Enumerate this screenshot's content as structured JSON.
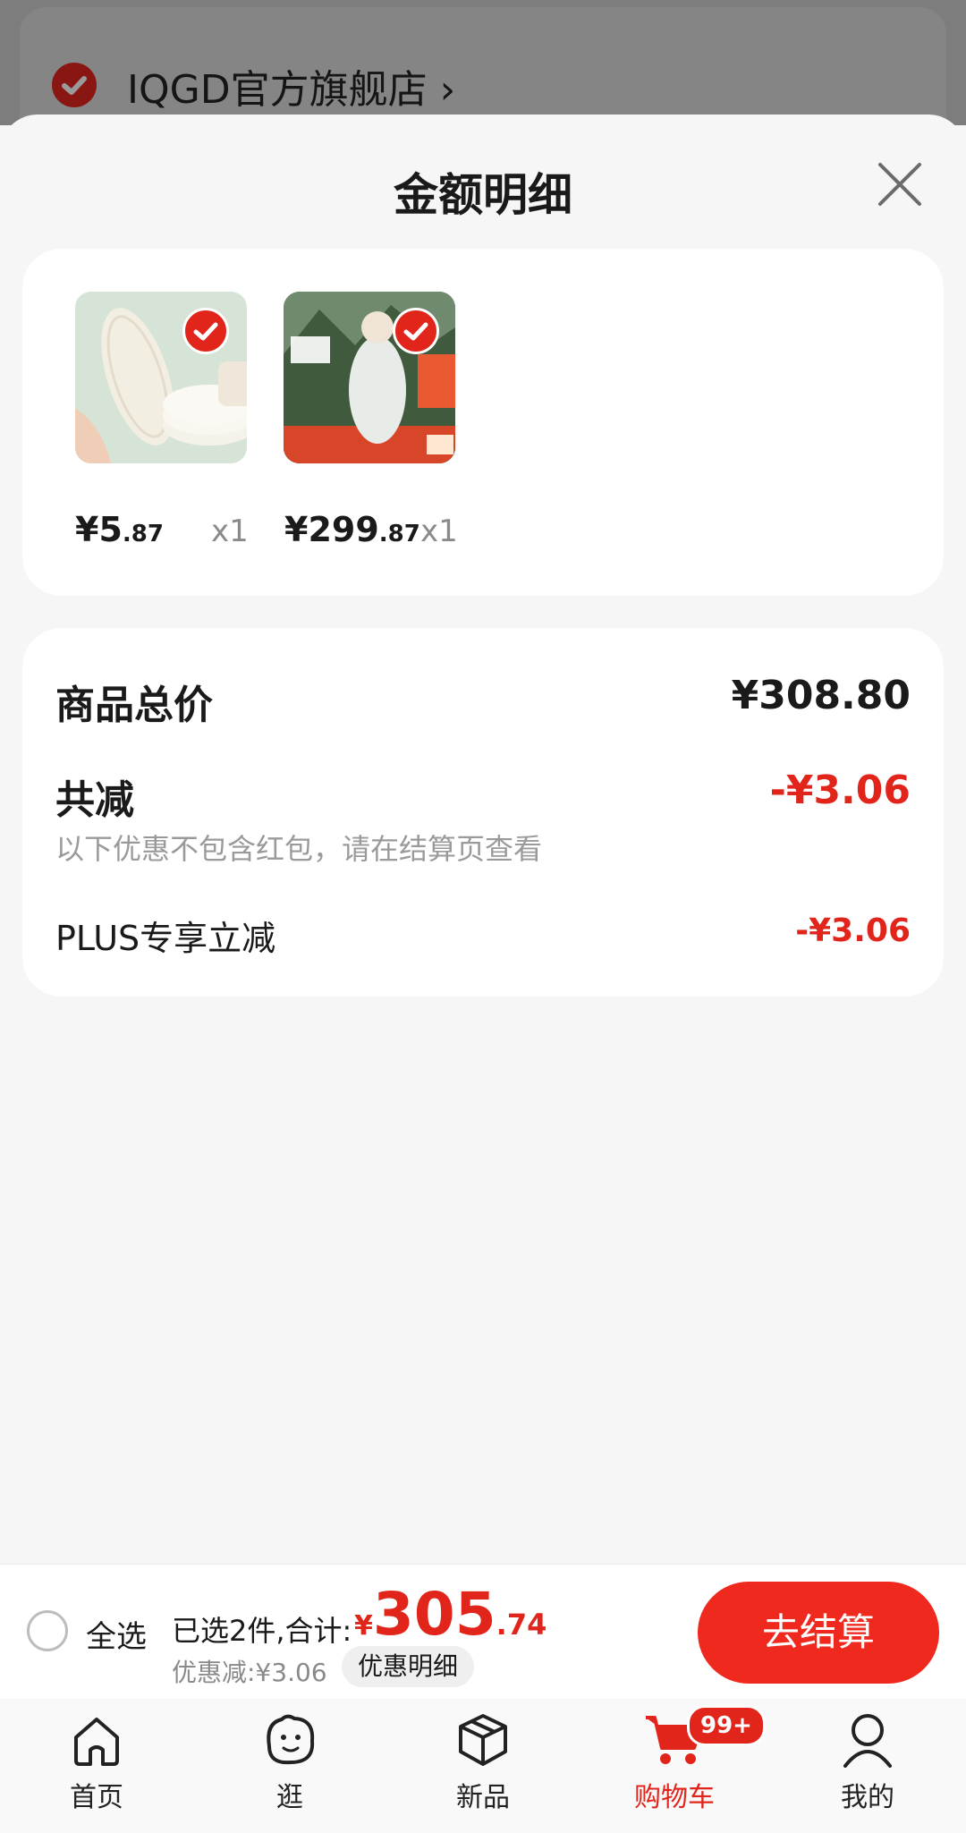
{
  "background": {
    "store_name": "IQGD官方旗舰店",
    "chevron": "›"
  },
  "sheet": {
    "title": "金额明细",
    "close_icon": "close-icon"
  },
  "products": [
    {
      "price_int": "¥5",
      "price_dec": ".87",
      "qty": "x1",
      "checked": true
    },
    {
      "price_int": "¥299",
      "price_dec": ".87",
      "qty": "x1",
      "checked": true
    }
  ],
  "summary": {
    "goods_total_label": "商品总价",
    "goods_total_value": "¥308.80",
    "discount_label": "共减",
    "discount_value": "-¥3.06",
    "discount_note": "以下优惠不包含红包，请在结算页查看",
    "plus_label": "PLUS专享立减",
    "plus_value": "-¥3.06"
  },
  "checkout": {
    "select_all": "全选",
    "selected_text": "已选2件,合计:",
    "total_currency": "¥",
    "total_int": "305",
    "total_dec": ".74",
    "discount_text": "优惠减:¥3.06",
    "detail_chip": "优惠明细",
    "checkout_button": "去结算"
  },
  "tabs": [
    {
      "label": "首页",
      "icon": "home-icon"
    },
    {
      "label": "逛",
      "icon": "face-icon"
    },
    {
      "label": "新品",
      "icon": "box-icon"
    },
    {
      "label": "购物车",
      "icon": "cart-icon",
      "active": true,
      "badge": "99+"
    },
    {
      "label": "我的",
      "icon": "user-icon"
    }
  ],
  "colors": {
    "accent": "#e1251b",
    "button": "#f0291f",
    "background": "#f6f6f6"
  }
}
